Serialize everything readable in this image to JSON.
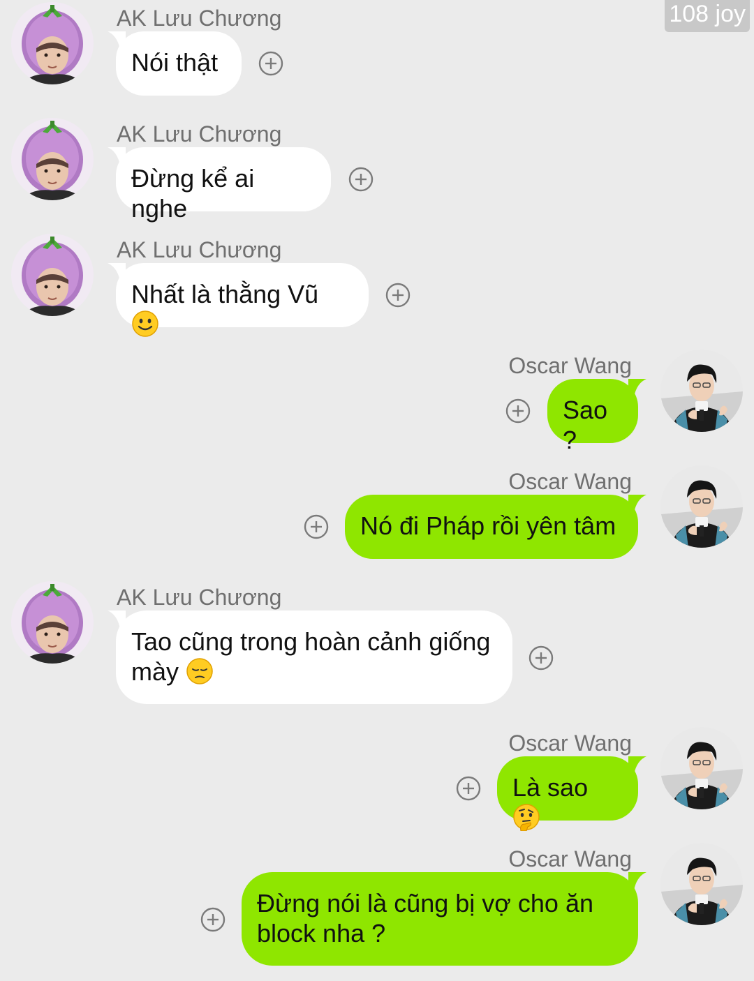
{
  "watermark": "108 joy",
  "colors": {
    "background": "#ebebeb",
    "incoming_bubble": "#ffffff",
    "outgoing_bubble": "#8fe600",
    "name_text": "#6f6f6f"
  },
  "messages": [
    {
      "sender": "AK Lưu Chương",
      "text": "Nói thật",
      "emoji": ""
    },
    {
      "sender": "AK Lưu Chương",
      "text": "Đừng kể ai nghe",
      "emoji": ""
    },
    {
      "sender": "AK Lưu Chương",
      "text": "Nhất là thằng Vũ",
      "emoji": "smiling-face-icon"
    },
    {
      "sender": "Oscar Wang",
      "text": "Sao ?",
      "emoji": ""
    },
    {
      "sender": "Oscar Wang",
      "text": "Nó đi Pháp rồi yên tâm",
      "emoji": ""
    },
    {
      "sender": "AK Lưu Chương",
      "text": "Tao cũng trong hoàn cảnh giống",
      "text2": "mày",
      "emoji": "pensive-face-icon"
    },
    {
      "sender": "Oscar Wang",
      "text": "Là sao",
      "emoji": "thinking-face-icon"
    },
    {
      "sender": "Oscar Wang",
      "text": "Đừng nói là cũng bị vợ cho ăn",
      "text2": "block nha ?",
      "emoji": ""
    }
  ],
  "icons": {
    "reaction": "add-reaction-icon",
    "avatar_ak": "eggplant-hat-avatar",
    "avatar_oscar": "oscar-avatar"
  }
}
